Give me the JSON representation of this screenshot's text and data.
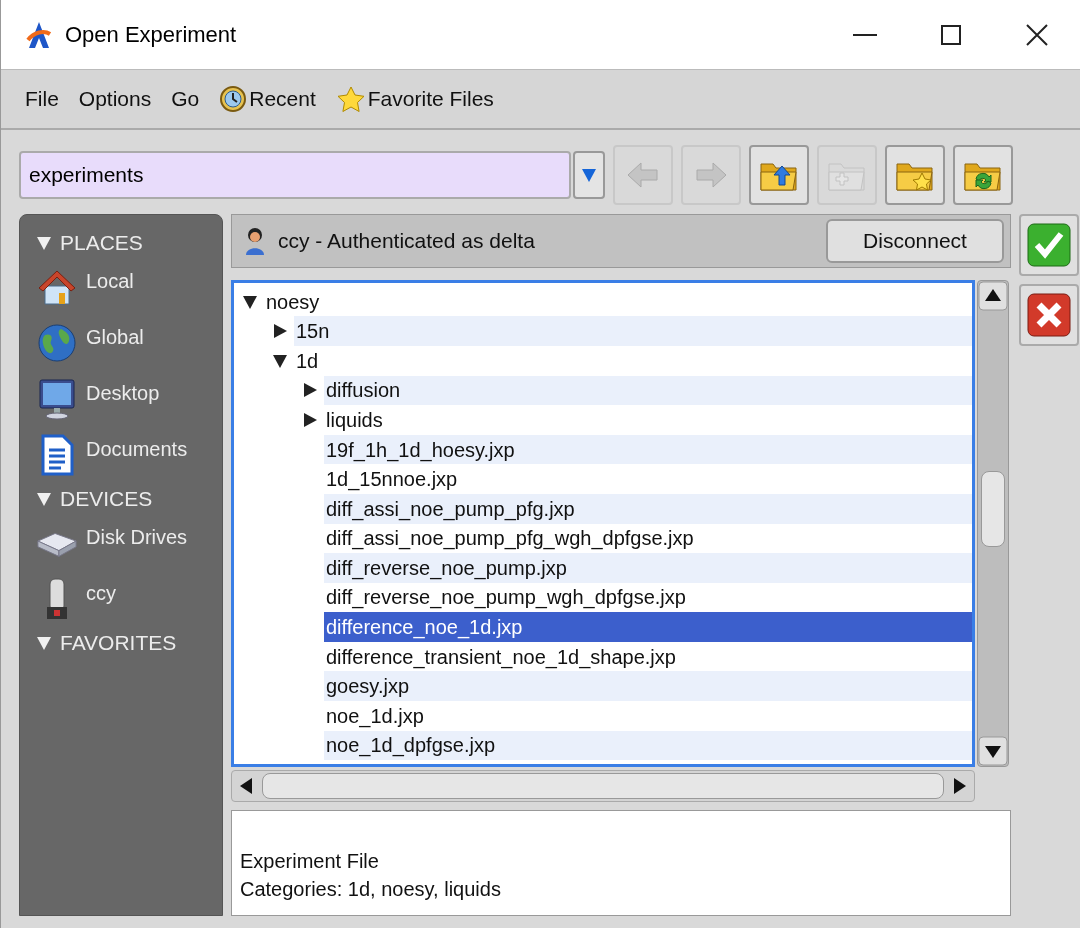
{
  "window": {
    "title": "Open Experiment"
  },
  "menu": [
    {
      "label": "File"
    },
    {
      "label": "Options"
    },
    {
      "label": "Go"
    },
    {
      "label": "Recent",
      "kind": "clock"
    },
    {
      "label": "Favorite Files",
      "kind": "star"
    }
  ],
  "path_field": {
    "value": "experiments"
  },
  "toolbar": [
    {
      "kind": "back",
      "disabled": true
    },
    {
      "kind": "forward",
      "disabled": true
    },
    {
      "kind": "up",
      "disabled": false
    },
    {
      "kind": "new",
      "disabled": true
    },
    {
      "kind": "favorite",
      "disabled": false
    },
    {
      "kind": "refresh",
      "disabled": false
    }
  ],
  "sidebar": [
    {
      "label": "PLACES",
      "expanded": true,
      "items": [
        {
          "label": "Local",
          "kind": "house"
        },
        {
          "label": "Global",
          "kind": "globe"
        },
        {
          "label": "Desktop",
          "kind": "monitor"
        },
        {
          "label": "Documents",
          "kind": "document"
        }
      ]
    },
    {
      "label": "DEVICES",
      "expanded": true,
      "items": [
        {
          "label": "Disk Drives",
          "kind": "drive"
        },
        {
          "label": "ccy",
          "kind": "server"
        }
      ]
    },
    {
      "label": "FAVORITES",
      "expanded": true
    }
  ],
  "connection": {
    "label": "ccy - Authenticated as delta",
    "button": "Disconnect"
  },
  "tree": [
    {
      "label": "noesy",
      "kind": "folder",
      "expanded": true,
      "selected": false,
      "children": [
        {
          "label": "15n",
          "kind": "folder",
          "expanded": false,
          "selected": false
        },
        {
          "label": "1d",
          "kind": "folder",
          "expanded": true,
          "selected": false,
          "children": [
            {
              "label": "diffusion",
              "kind": "folder",
              "expanded": false,
              "selected": false
            },
            {
              "label": "liquids",
              "kind": "folder",
              "expanded": false,
              "selected": false
            },
            {
              "label": "19f_1h_1d_hoesy.jxp",
              "kind": "file",
              "selected": false
            },
            {
              "label": "1d_15nnoe.jxp",
              "kind": "file",
              "selected": false
            },
            {
              "label": "diff_assi_noe_pump_pfg.jxp",
              "kind": "file",
              "selected": false
            },
            {
              "label": "diff_assi_noe_pump_pfg_wgh_dpfgse.jxp",
              "kind": "file",
              "selected": false
            },
            {
              "label": "diff_reverse_noe_pump.jxp",
              "kind": "file",
              "selected": false
            },
            {
              "label": "diff_reverse_noe_pump_wgh_dpfgse.jxp",
              "kind": "file",
              "selected": false
            },
            {
              "label": "difference_noe_1d.jxp",
              "kind": "file",
              "selected": true
            },
            {
              "label": "difference_transient_noe_1d_shape.jxp",
              "kind": "file",
              "selected": false
            },
            {
              "label": "goesy.jxp",
              "kind": "file",
              "selected": false
            },
            {
              "label": "noe_1d.jxp",
              "kind": "file",
              "selected": false
            },
            {
              "label": "noe_1d_dpfgse.jxp",
              "kind": "file",
              "selected": false
            }
          ]
        }
      ]
    }
  ],
  "info": [
    "Experiment File",
    "Categories: 1d, noesy, liquids"
  ]
}
